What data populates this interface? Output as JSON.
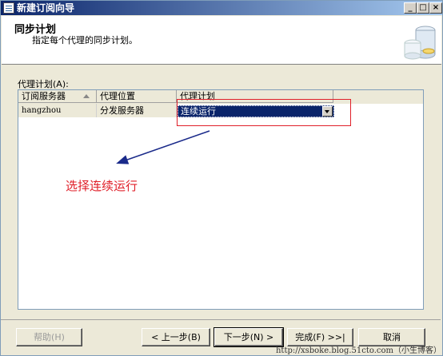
{
  "window": {
    "title": "新建订阅向导",
    "min_label": "_",
    "max_label": "□",
    "close_label": "×"
  },
  "header": {
    "title": "同步计划",
    "subtitle": "指定每个代理的同步计划。"
  },
  "grid": {
    "label": "代理计划(A):",
    "columns": [
      "订阅服务器",
      "代理位置",
      "代理计划"
    ],
    "rows": [
      {
        "subscriber": "hangzhou",
        "location": "分发服务器",
        "schedule": "连续运行"
      }
    ]
  },
  "annotation": {
    "text": "选择连续运行"
  },
  "footer": {
    "help": "帮助(H)",
    "back": "< 上一步(B)",
    "next": "下一步(N) >",
    "finish": "完成(F) >>|",
    "cancel": "取消"
  },
  "watermark": "http://xsboke.blog.51cto.com（小生博客）",
  "colors": {
    "title_bar": "#0a246a",
    "selection": "#0a246a",
    "annotation": "#e0202a",
    "arrow": "#1a2a8a"
  }
}
